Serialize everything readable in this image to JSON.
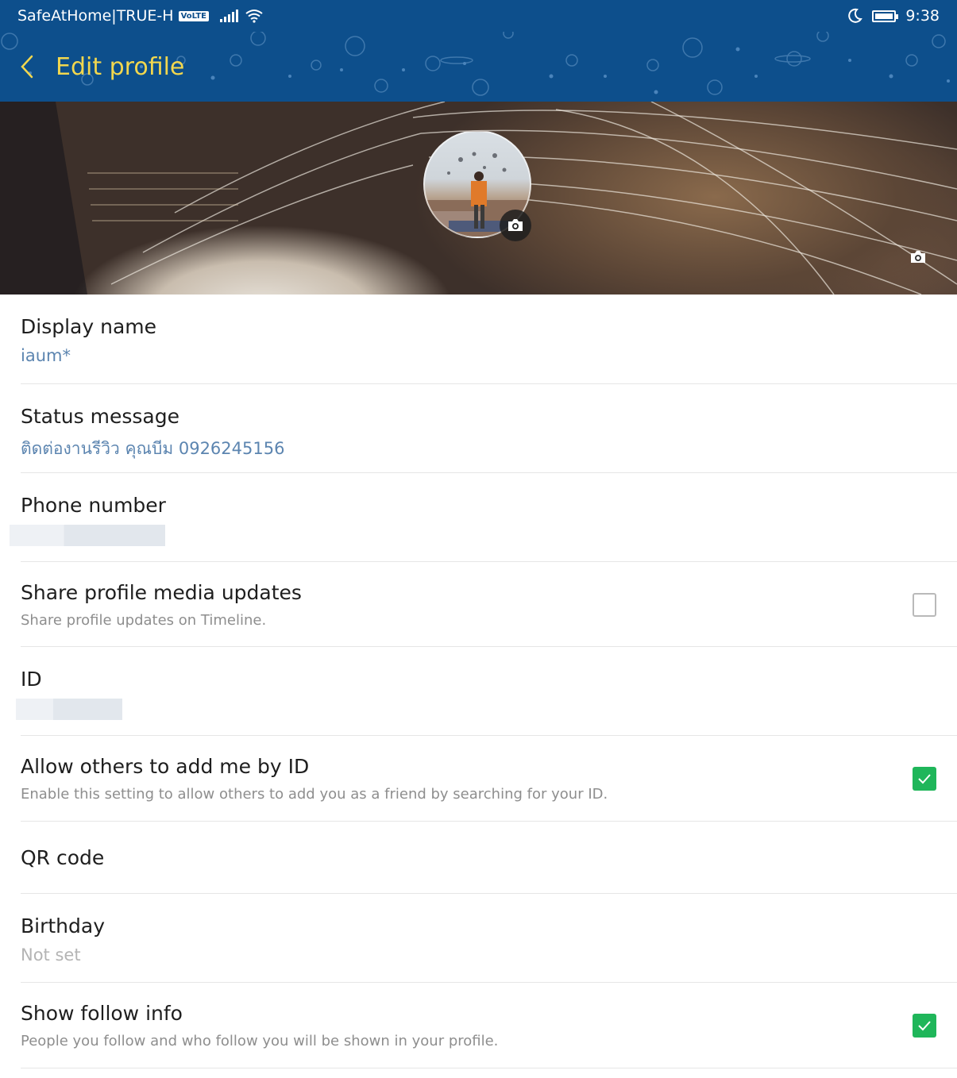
{
  "status_bar": {
    "carrier": "SafeAtHome|TRUE-H",
    "volte": "VoLTE",
    "time": "9:38"
  },
  "header": {
    "title": "Edit profile"
  },
  "profile": {
    "display_name": {
      "label": "Display name",
      "value": "iaum*"
    },
    "status_message": {
      "label": "Status message",
      "value": "ติดต่องานรีวิว คุณบีม 0926245156"
    },
    "phone_number": {
      "label": "Phone number"
    },
    "share_updates": {
      "label": "Share profile media updates",
      "description": "Share profile updates on Timeline.",
      "checked": false
    },
    "id": {
      "label": "ID"
    },
    "allow_add_by_id": {
      "label": "Allow others to add me by ID",
      "description": "Enable this setting to allow others to add you as a friend by searching for your ID.",
      "checked": true
    },
    "qr_code": {
      "label": "QR code"
    },
    "birthday": {
      "label": "Birthday",
      "value": "Not set"
    },
    "show_follow_info": {
      "label": "Show follow info",
      "description": "People you follow and who follow you will be shown in your profile.",
      "checked": true
    }
  },
  "colors": {
    "header_bg": "#0d4f8c",
    "title": "#f2d74e",
    "accent_value": "#5c85b0",
    "check_green": "#1fb65a"
  }
}
